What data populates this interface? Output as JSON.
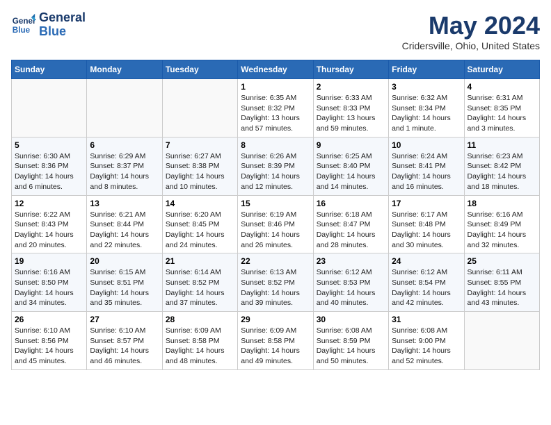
{
  "header": {
    "logo_line1": "General",
    "logo_line2": "Blue",
    "title": "May 2024",
    "subtitle": "Cridersville, Ohio, United States"
  },
  "days_of_week": [
    "Sunday",
    "Monday",
    "Tuesday",
    "Wednesday",
    "Thursday",
    "Friday",
    "Saturday"
  ],
  "weeks": [
    [
      {
        "num": "",
        "info": ""
      },
      {
        "num": "",
        "info": ""
      },
      {
        "num": "",
        "info": ""
      },
      {
        "num": "1",
        "info": "Sunrise: 6:35 AM\nSunset: 8:32 PM\nDaylight: 13 hours and 57 minutes."
      },
      {
        "num": "2",
        "info": "Sunrise: 6:33 AM\nSunset: 8:33 PM\nDaylight: 13 hours and 59 minutes."
      },
      {
        "num": "3",
        "info": "Sunrise: 6:32 AM\nSunset: 8:34 PM\nDaylight: 14 hours and 1 minute."
      },
      {
        "num": "4",
        "info": "Sunrise: 6:31 AM\nSunset: 8:35 PM\nDaylight: 14 hours and 3 minutes."
      }
    ],
    [
      {
        "num": "5",
        "info": "Sunrise: 6:30 AM\nSunset: 8:36 PM\nDaylight: 14 hours and 6 minutes."
      },
      {
        "num": "6",
        "info": "Sunrise: 6:29 AM\nSunset: 8:37 PM\nDaylight: 14 hours and 8 minutes."
      },
      {
        "num": "7",
        "info": "Sunrise: 6:27 AM\nSunset: 8:38 PM\nDaylight: 14 hours and 10 minutes."
      },
      {
        "num": "8",
        "info": "Sunrise: 6:26 AM\nSunset: 8:39 PM\nDaylight: 14 hours and 12 minutes."
      },
      {
        "num": "9",
        "info": "Sunrise: 6:25 AM\nSunset: 8:40 PM\nDaylight: 14 hours and 14 minutes."
      },
      {
        "num": "10",
        "info": "Sunrise: 6:24 AM\nSunset: 8:41 PM\nDaylight: 14 hours and 16 minutes."
      },
      {
        "num": "11",
        "info": "Sunrise: 6:23 AM\nSunset: 8:42 PM\nDaylight: 14 hours and 18 minutes."
      }
    ],
    [
      {
        "num": "12",
        "info": "Sunrise: 6:22 AM\nSunset: 8:43 PM\nDaylight: 14 hours and 20 minutes."
      },
      {
        "num": "13",
        "info": "Sunrise: 6:21 AM\nSunset: 8:44 PM\nDaylight: 14 hours and 22 minutes."
      },
      {
        "num": "14",
        "info": "Sunrise: 6:20 AM\nSunset: 8:45 PM\nDaylight: 14 hours and 24 minutes."
      },
      {
        "num": "15",
        "info": "Sunrise: 6:19 AM\nSunset: 8:46 PM\nDaylight: 14 hours and 26 minutes."
      },
      {
        "num": "16",
        "info": "Sunrise: 6:18 AM\nSunset: 8:47 PM\nDaylight: 14 hours and 28 minutes."
      },
      {
        "num": "17",
        "info": "Sunrise: 6:17 AM\nSunset: 8:48 PM\nDaylight: 14 hours and 30 minutes."
      },
      {
        "num": "18",
        "info": "Sunrise: 6:16 AM\nSunset: 8:49 PM\nDaylight: 14 hours and 32 minutes."
      }
    ],
    [
      {
        "num": "19",
        "info": "Sunrise: 6:16 AM\nSunset: 8:50 PM\nDaylight: 14 hours and 34 minutes."
      },
      {
        "num": "20",
        "info": "Sunrise: 6:15 AM\nSunset: 8:51 PM\nDaylight: 14 hours and 35 minutes."
      },
      {
        "num": "21",
        "info": "Sunrise: 6:14 AM\nSunset: 8:52 PM\nDaylight: 14 hours and 37 minutes."
      },
      {
        "num": "22",
        "info": "Sunrise: 6:13 AM\nSunset: 8:52 PM\nDaylight: 14 hours and 39 minutes."
      },
      {
        "num": "23",
        "info": "Sunrise: 6:12 AM\nSunset: 8:53 PM\nDaylight: 14 hours and 40 minutes."
      },
      {
        "num": "24",
        "info": "Sunrise: 6:12 AM\nSunset: 8:54 PM\nDaylight: 14 hours and 42 minutes."
      },
      {
        "num": "25",
        "info": "Sunrise: 6:11 AM\nSunset: 8:55 PM\nDaylight: 14 hours and 43 minutes."
      }
    ],
    [
      {
        "num": "26",
        "info": "Sunrise: 6:10 AM\nSunset: 8:56 PM\nDaylight: 14 hours and 45 minutes."
      },
      {
        "num": "27",
        "info": "Sunrise: 6:10 AM\nSunset: 8:57 PM\nDaylight: 14 hours and 46 minutes."
      },
      {
        "num": "28",
        "info": "Sunrise: 6:09 AM\nSunset: 8:58 PM\nDaylight: 14 hours and 48 minutes."
      },
      {
        "num": "29",
        "info": "Sunrise: 6:09 AM\nSunset: 8:58 PM\nDaylight: 14 hours and 49 minutes."
      },
      {
        "num": "30",
        "info": "Sunrise: 6:08 AM\nSunset: 8:59 PM\nDaylight: 14 hours and 50 minutes."
      },
      {
        "num": "31",
        "info": "Sunrise: 6:08 AM\nSunset: 9:00 PM\nDaylight: 14 hours and 52 minutes."
      },
      {
        "num": "",
        "info": ""
      }
    ]
  ]
}
